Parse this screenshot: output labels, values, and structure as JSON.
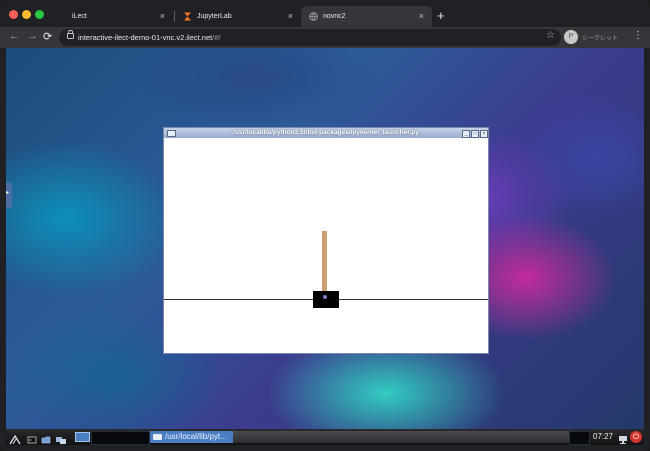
{
  "browser": {
    "traffic_lights": {
      "close_color": "#ff5f57",
      "minimize_color": "#febc2e",
      "maximize_color": "#28c840"
    },
    "tabs": [
      {
        "label": "iLect",
        "icon": "blank-page-icon"
      },
      {
        "label": "JupyterLab",
        "icon": "hourglass-icon",
        "icon_color": "#f37726"
      },
      {
        "label": "novnc2",
        "icon": "globe-icon",
        "active": true
      }
    ],
    "close_glyph": "×",
    "new_tab_glyph": "+",
    "url_host": "interactive-ilect-demo-01-vnc.v2.ilect.net",
    "url_path": "/#/",
    "profile_label": "シークレット",
    "profile_initial": "P"
  },
  "desktop": {
    "window": {
      "title": "/usr/local/lib/python3.5/dist-packages/ipykernel_launcher.py",
      "content": "cartpole-render",
      "colors": {
        "cart": "#000000",
        "pole": "#caa072",
        "axle": "#8080cc",
        "track": "#333333"
      }
    },
    "taskbar": {
      "task_label": "/usr/local/lib/pyt...",
      "clock": "07:27",
      "power_glyph": "⏻"
    }
  }
}
